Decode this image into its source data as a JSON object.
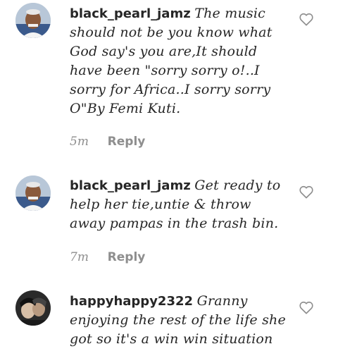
{
  "comments": [
    {
      "username": "black_pearl_jamz",
      "text": "The music should not be you know what God say's you are,It should have been \"sorry sorry o!..I sorry for Africa..I sorry sorry O\"By Femi Kuti.",
      "time": "5m",
      "reply": "Reply",
      "avatar_icon": "profile-photo"
    },
    {
      "username": "black_pearl_jamz",
      "text": "Get ready to help her tie,untie & throw away pampas in the trash bin.",
      "time": "7m",
      "reply": "Reply",
      "avatar_icon": "profile-photo"
    },
    {
      "username": "happyhappy2322",
      "text": "Granny enjoying the rest of the life she got so it's a win win situation",
      "avatar_icon": "profile-photo"
    }
  ],
  "icons": {
    "like": "heart-outline-icon"
  },
  "colors": {
    "text": "#262626",
    "muted": "#8e8e8e",
    "background": "#ffffff"
  }
}
